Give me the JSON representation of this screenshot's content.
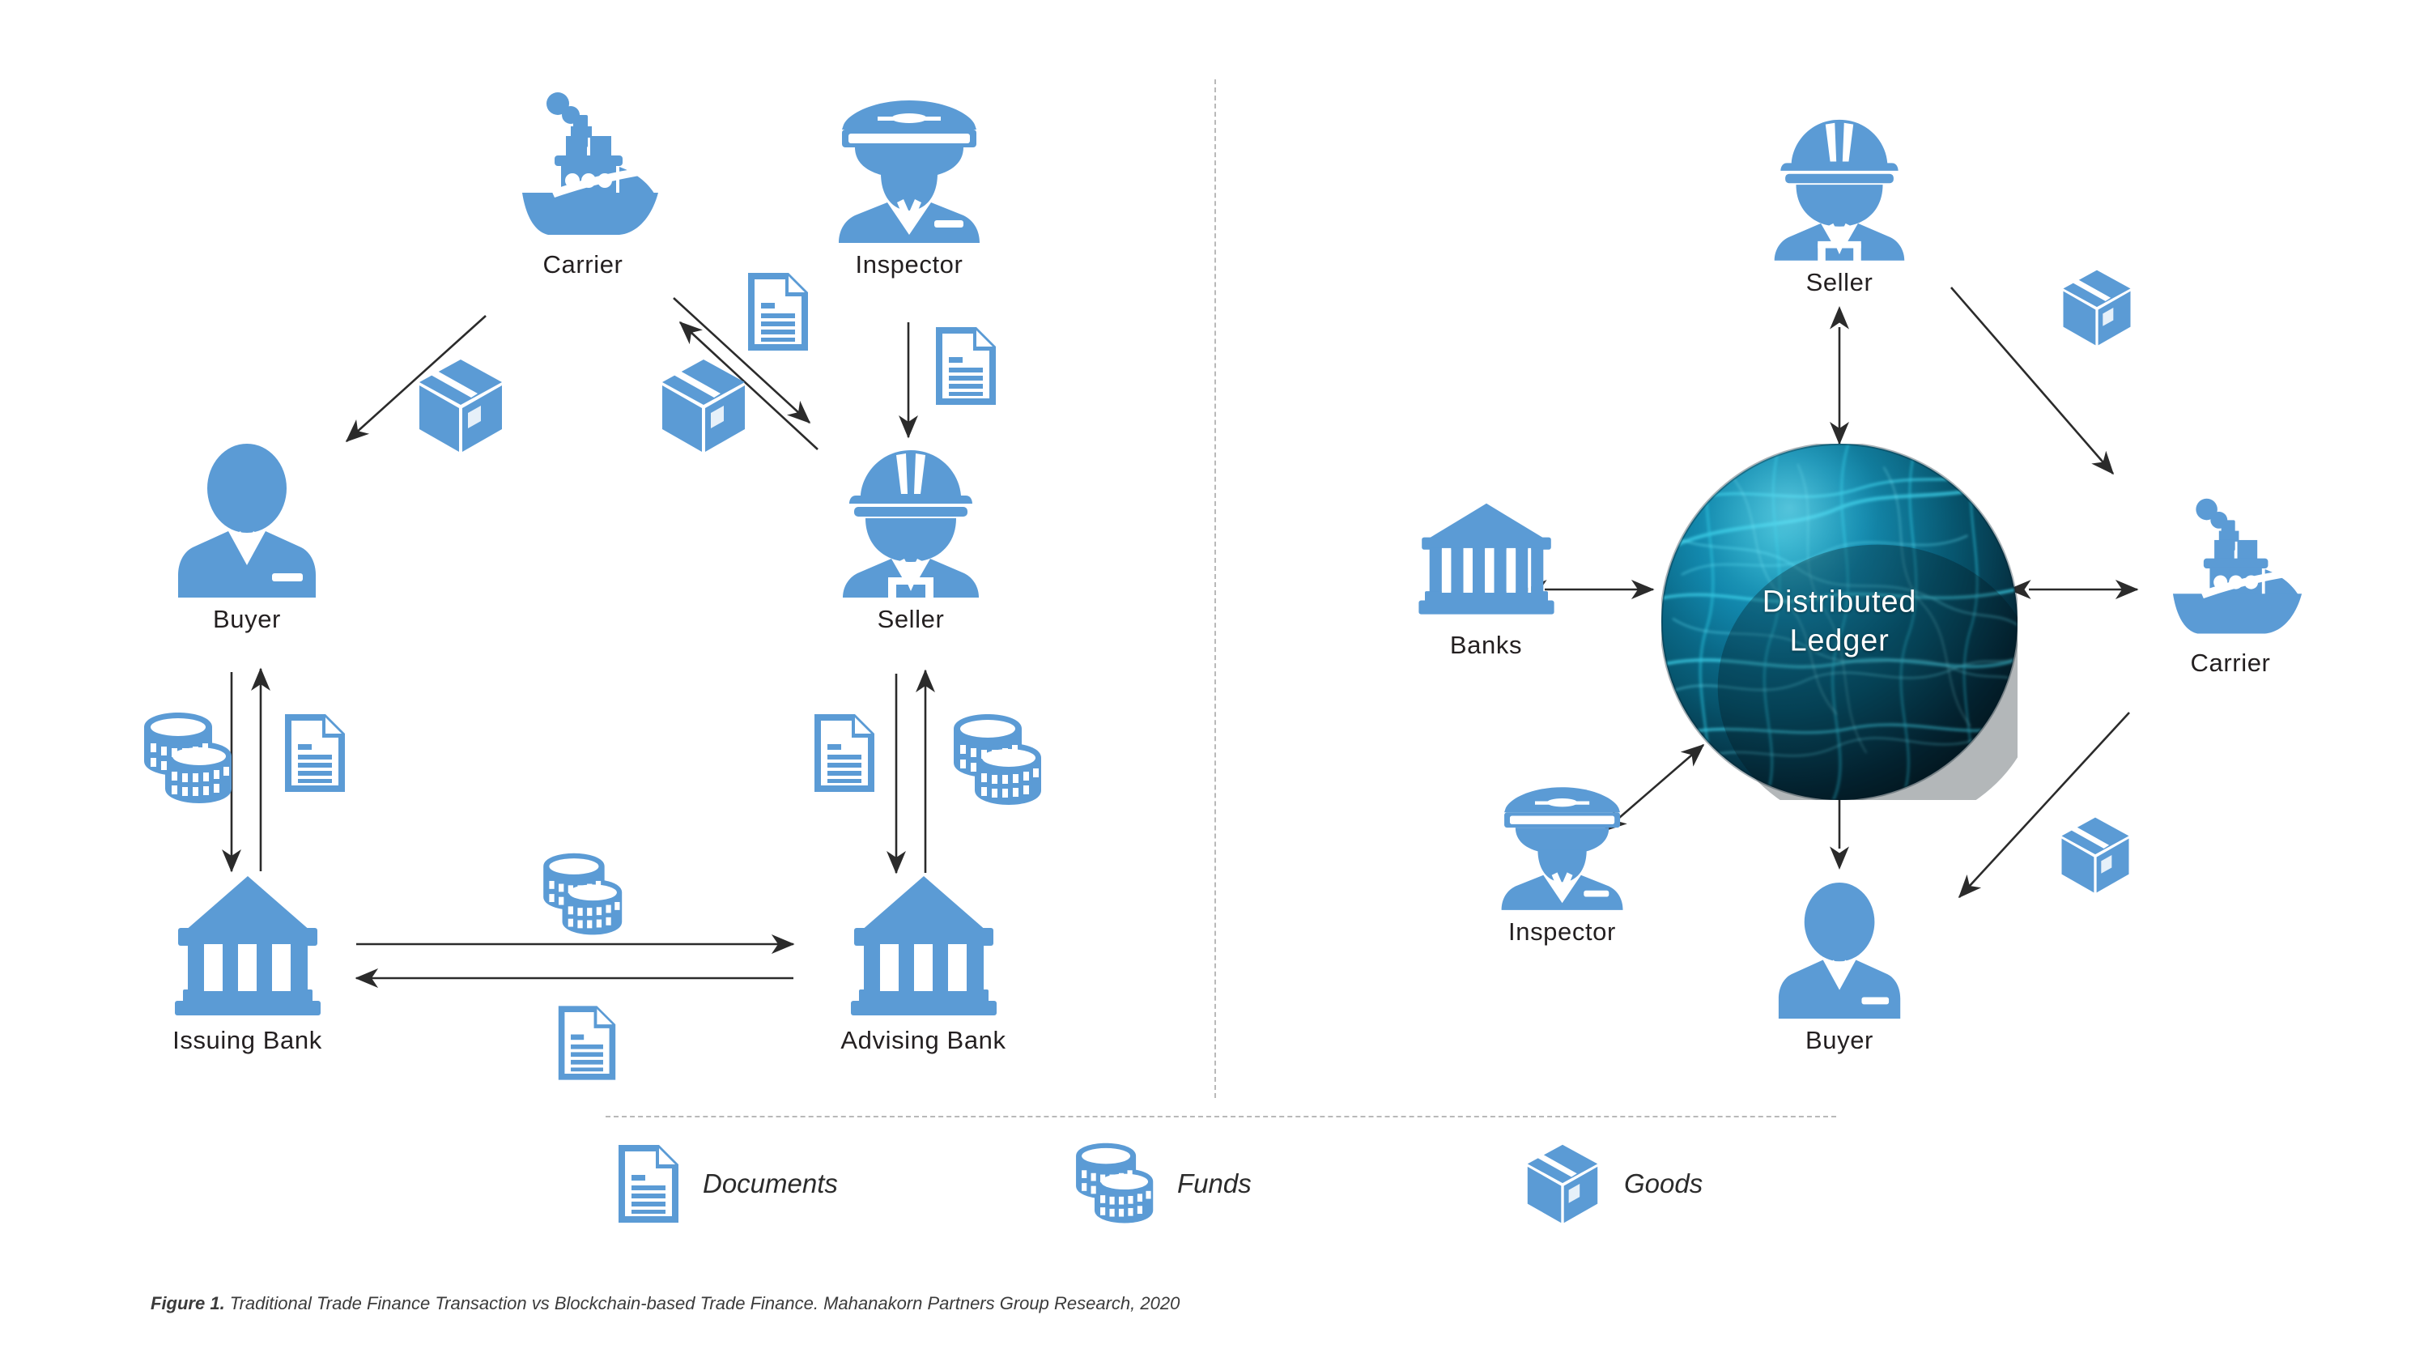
{
  "figure": {
    "caption_bold": "Figure 1.",
    "caption_rest": " Traditional Trade Finance Transaction vs Blockchain-based Trade Finance. Mahanakorn Partners Group Research, 2020"
  },
  "colors": {
    "icon_blue": "#5B9BD5",
    "arrow_dark": "#2b2b2b",
    "label_text": "#231f20",
    "divider": "#b9b9b9",
    "ledger_text": "#ffffff",
    "globe_deep": "#072a3a",
    "globe_mid": "#0a6b8c",
    "globe_bright": "#2fd0e8",
    "background": "#ffffff"
  },
  "left_panel": {
    "title": "Traditional Trade Finance Transaction",
    "nodes": [
      {
        "id": "carrier",
        "label": "Carrier",
        "icon": "ship-icon"
      },
      {
        "id": "inspector",
        "label": "Inspector",
        "icon": "inspector-icon"
      },
      {
        "id": "buyer",
        "label": "Buyer",
        "icon": "businessman-icon"
      },
      {
        "id": "seller",
        "label": "Seller",
        "icon": "worker-icon"
      },
      {
        "id": "issuing-bank",
        "label": "Issuing Bank",
        "icon": "bank-icon"
      },
      {
        "id": "advising-bank",
        "label": "Advising Bank",
        "icon": "bank-icon"
      }
    ],
    "flows": [
      {
        "from": "carrier",
        "to": "buyer",
        "carries": "Goods"
      },
      {
        "from": "seller",
        "to": "carrier",
        "carries": "Goods"
      },
      {
        "from": "carrier",
        "to": "seller",
        "carries": "Documents"
      },
      {
        "from": "inspector",
        "to": "seller",
        "carries": "Documents"
      },
      {
        "from": "buyer",
        "to": "issuing-bank",
        "carries": "Funds"
      },
      {
        "from": "issuing-bank",
        "to": "buyer",
        "carries": "Documents"
      },
      {
        "from": "seller",
        "to": "advising-bank",
        "carries": "Documents"
      },
      {
        "from": "advising-bank",
        "to": "seller",
        "carries": "Funds"
      },
      {
        "from": "issuing-bank",
        "to": "advising-bank",
        "carries": "Funds"
      },
      {
        "from": "advising-bank",
        "to": "issuing-bank",
        "carries": "Documents"
      }
    ]
  },
  "right_panel": {
    "title": "Blockchain-based Trade Finance",
    "hub": {
      "id": "distributed-ledger",
      "line1": "Distributed",
      "line2": "Ledger"
    },
    "nodes": [
      {
        "id": "seller",
        "label": "Seller",
        "icon": "worker-icon"
      },
      {
        "id": "banks",
        "label": "Banks",
        "icon": "bank-icon"
      },
      {
        "id": "carrier",
        "label": "Carrier",
        "icon": "ship-icon"
      },
      {
        "id": "inspector",
        "label": "Inspector",
        "icon": "inspector-icon"
      },
      {
        "id": "buyer",
        "label": "Buyer",
        "icon": "businessman-icon"
      }
    ],
    "flows": [
      {
        "from": "seller",
        "to": "distributed-ledger",
        "bidirectional": true
      },
      {
        "from": "banks",
        "to": "distributed-ledger",
        "bidirectional": true
      },
      {
        "from": "carrier",
        "to": "distributed-ledger",
        "bidirectional": true
      },
      {
        "from": "inspector",
        "to": "distributed-ledger",
        "bidirectional": true
      },
      {
        "from": "buyer",
        "to": "distributed-ledger",
        "bidirectional": true
      },
      {
        "from": "seller",
        "to": "carrier",
        "carries": "Goods"
      },
      {
        "from": "carrier",
        "to": "buyer",
        "carries": "Goods"
      }
    ]
  },
  "legend": {
    "items": [
      {
        "id": "documents",
        "label": "Documents",
        "icon": "document-icon"
      },
      {
        "id": "funds",
        "label": "Funds",
        "icon": "coins-icon"
      },
      {
        "id": "goods",
        "label": "Goods",
        "icon": "box-icon"
      }
    ]
  }
}
